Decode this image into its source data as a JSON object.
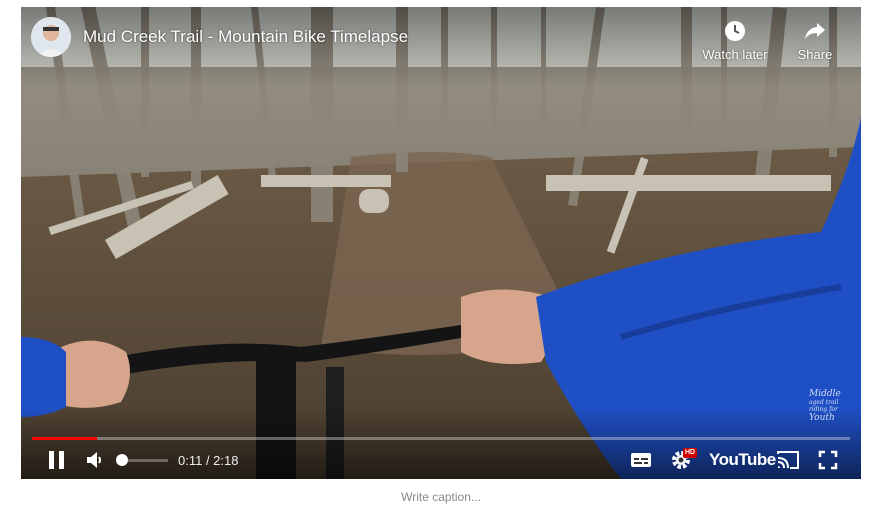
{
  "video": {
    "title": "Mud Creek Trail - Mountain Bike Timelapse",
    "channel_avatar": "channel-avatar"
  },
  "top_actions": {
    "watch_later_label": "Watch later",
    "watch_later_icon": "clock-icon",
    "share_label": "Share",
    "share_icon": "share-arrow-icon"
  },
  "watermark": {
    "line1": "Middle",
    "line2": "aged trail",
    "line3": "riding for",
    "line4": "Youth"
  },
  "playback": {
    "current_time": "0:11",
    "duration": "2:18",
    "time_display": "0:11 / 2:18",
    "progress_fraction": 0.08,
    "volume_fraction": 0.0,
    "state": "playing"
  },
  "controls": {
    "pause_icon": "pause-icon",
    "volume_icon": "volume-icon",
    "cc_icon": "subtitles-icon",
    "settings_icon": "gear-icon",
    "hd_badge": "HD",
    "logo_text": "YouTube",
    "cast_icon": "cast-icon",
    "fullscreen_icon": "fullscreen-icon"
  },
  "colors": {
    "progress_played": "#ff0000",
    "hd_badge": "#cc0000",
    "jacket": "#1f4fc4"
  },
  "caption": {
    "placeholder": "Write caption..."
  }
}
